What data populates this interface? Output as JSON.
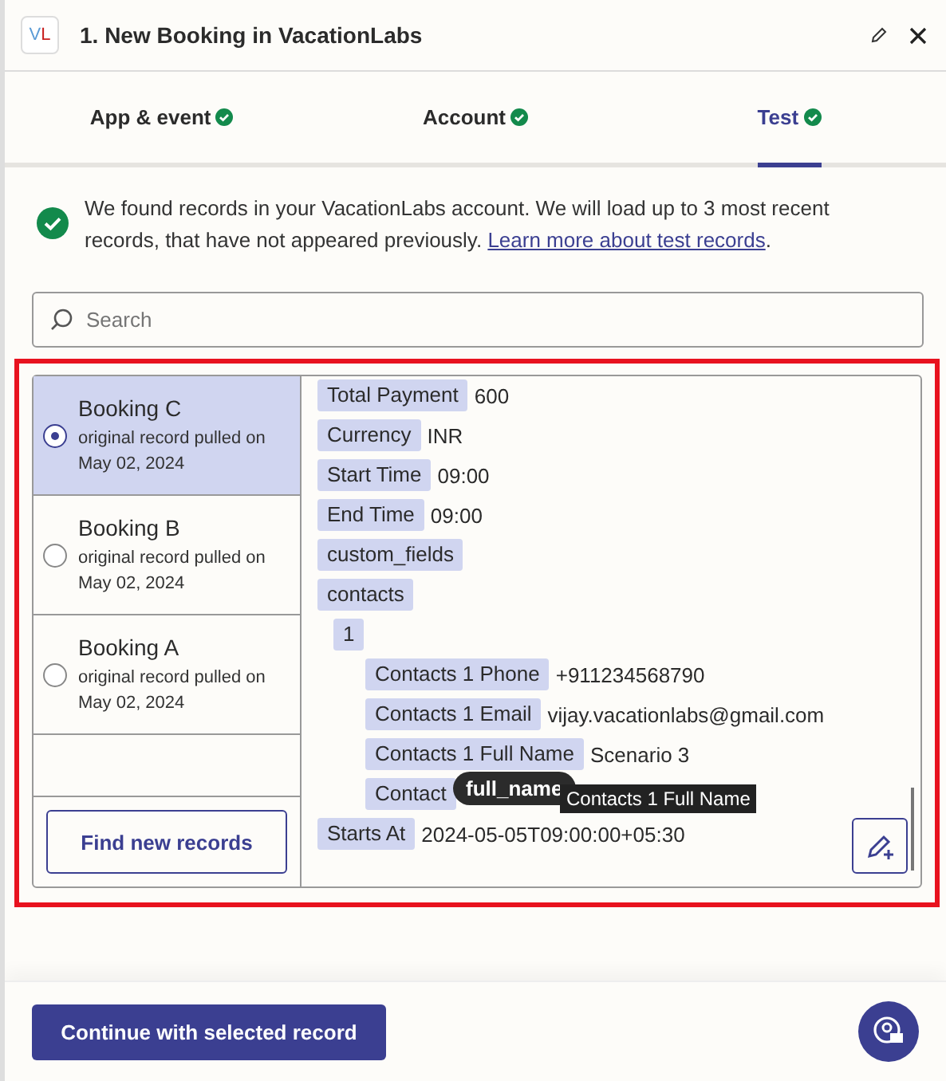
{
  "header": {
    "logo": "VL",
    "title": "1. New Booking in VacationLabs"
  },
  "tabs": [
    {
      "label": "App & event",
      "selected": false,
      "complete": true
    },
    {
      "label": "Account",
      "selected": false,
      "complete": true
    },
    {
      "label": "Test",
      "selected": true,
      "complete": true
    }
  ],
  "notice": {
    "text": "We found records in your VacationLabs account. We will load up to 3 most recent records, that have not appeared previously.",
    "link": "Learn more about test records",
    "after": "."
  },
  "search": {
    "placeholder": "Search"
  },
  "records": [
    {
      "title": "Booking C",
      "subtitle": "original record pulled on May 02, 2024",
      "selected": true
    },
    {
      "title": "Booking B",
      "subtitle": "original record pulled on May 02, 2024",
      "selected": false
    },
    {
      "title": "Booking A",
      "subtitle": "original record pulled on May 02, 2024",
      "selected": false
    }
  ],
  "find_button": "Find new records",
  "fields": [
    {
      "key": "Total Payment",
      "value": "600"
    },
    {
      "key": "Currency",
      "value": "INR"
    },
    {
      "key": "Start Time",
      "value": "09:00"
    },
    {
      "key": "End Time",
      "value": "09:00"
    },
    {
      "key": "custom_fields"
    },
    {
      "key": "contacts",
      "children": [
        {
          "key": "1",
          "children": [
            {
              "key": "Contacts 1 Phone",
              "value": "+911234568790"
            },
            {
              "key": "Contacts 1 Email",
              "value": "vijay.vacationlabs@gmail.com"
            },
            {
              "key": "Contacts 1 Full Name",
              "value": "Scenario 3"
            },
            {
              "key": "Contact"
            }
          ]
        }
      ]
    },
    {
      "key": "Starts At",
      "value": "2024-05-05T09:00:00+05:30"
    }
  ],
  "drag_pill": "full_name",
  "tooltip": "Contacts 1 Full Name",
  "continue_button": "Continue with selected record"
}
